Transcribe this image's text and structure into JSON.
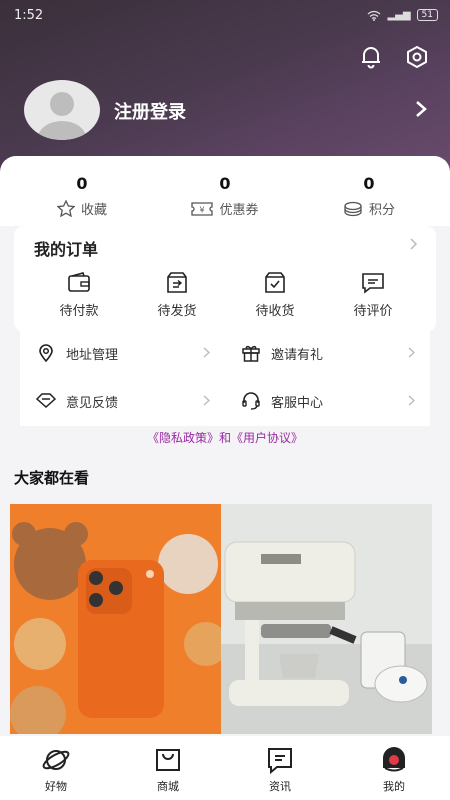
{
  "status": {
    "time": "1:52",
    "battery": "51"
  },
  "profile": {
    "login_label": "注册登录"
  },
  "stats": [
    {
      "count": "0",
      "label": "收藏",
      "icon": "star-icon"
    },
    {
      "count": "0",
      "label": "优惠券",
      "icon": "coupon-icon"
    },
    {
      "count": "0",
      "label": "积分",
      "icon": "points-icon"
    }
  ],
  "orders": {
    "title": "我的订单",
    "items": [
      {
        "label": "待付款",
        "icon": "wallet-icon"
      },
      {
        "label": "待发货",
        "icon": "shipping-box-icon"
      },
      {
        "label": "待收货",
        "icon": "receive-box-icon"
      },
      {
        "label": "待评价",
        "icon": "comment-icon"
      }
    ]
  },
  "services": [
    {
      "label": "地址管理",
      "icon": "location-icon"
    },
    {
      "label": "邀请有礼",
      "icon": "gift-icon"
    },
    {
      "label": "意见反馈",
      "icon": "feedback-icon"
    },
    {
      "label": "客服中心",
      "icon": "headset-icon"
    }
  ],
  "policy": {
    "privacy": "《隐私政策》",
    "and": "和",
    "agreement": "《用户协议》"
  },
  "feed": {
    "title": "大家都在看"
  },
  "tabbar": [
    {
      "label": "好物",
      "icon": "planet-icon"
    },
    {
      "label": "商城",
      "icon": "shopping-bag-icon"
    },
    {
      "label": "资讯",
      "icon": "news-icon"
    },
    {
      "label": "我的",
      "icon": "profile-icon"
    }
  ],
  "colors": {
    "header": "#4a3a4e",
    "accent_link": "#9b2aa3",
    "phone": "#f07f2c"
  }
}
